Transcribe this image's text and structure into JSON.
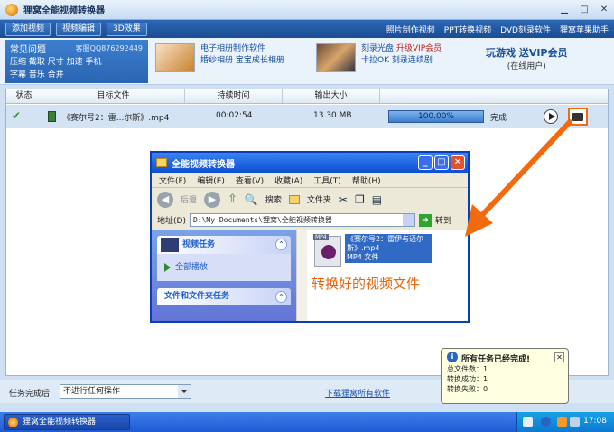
{
  "window": {
    "title": "狸窝全能视频转换器"
  },
  "toolbar": {
    "buttons": [
      "添加视频",
      "视频编辑",
      "3D效果"
    ],
    "links": [
      "照片制作视频",
      "PPT转换视频",
      "DVD刻录软件",
      "狸窝苹果助手"
    ]
  },
  "faq": {
    "title": "常见问题",
    "qq": "客服QQ876292449",
    "line1": "压缩  截取  尺寸  加速  手机",
    "line2": "字幕  音乐  合并"
  },
  "promo1": {
    "line1": "电子相册制作软件",
    "line2": "婚纱相册  宝宝成长相册"
  },
  "promo2": {
    "line1": "刻录光盘",
    "line1_red": "升级VIP会员",
    "line2": "卡拉OK  刻录连续剧"
  },
  "promo3": {
    "line1": "玩游戏  送VIP会员",
    "line2": "(在线用户)"
  },
  "table": {
    "headers": [
      "状态",
      "目标文件",
      "持续时间",
      "输出大小"
    ],
    "row": {
      "file": "《赛尔号2：雷...尔斯》.mp4",
      "duration": "00:02:54",
      "size": "13.30 MB",
      "progress_text": "100.00%",
      "progress": 1.0,
      "status": "完成"
    }
  },
  "explorer": {
    "title": "全能视频转换器",
    "menu": [
      "文件(F)",
      "编辑(E)",
      "查看(V)",
      "收藏(A)",
      "工具(T)",
      "帮助(H)"
    ],
    "tools": {
      "back": "后退",
      "search": "搜索",
      "folders": "文件夹"
    },
    "address_label": "地址(D)",
    "address": "D:\\My Documents\\狸窝\\全能视频转换器",
    "go": "转到",
    "tasks_title": "视频任务",
    "task_play_all": "全部播放",
    "tasks_title2": "文件和文件夹任务",
    "file_label": "《赛尔号2：雷伊与迈尔斯》.mp4",
    "file_type": "MP4 文件",
    "file_badge": "MP4"
  },
  "caption": "转换好的视频文件",
  "bottom": {
    "after_label": "任务完成后:",
    "after_value": "不进行任何操作",
    "download_link": "下载狸窝所有软件"
  },
  "balloon": {
    "title": "所有任务已经完成!",
    "total": "总文件数：1",
    "success": "转换成功：1",
    "fail": "转换失败：0"
  },
  "taskbar": {
    "app": "狸窝全能视频转换器",
    "clock": "17:08"
  }
}
